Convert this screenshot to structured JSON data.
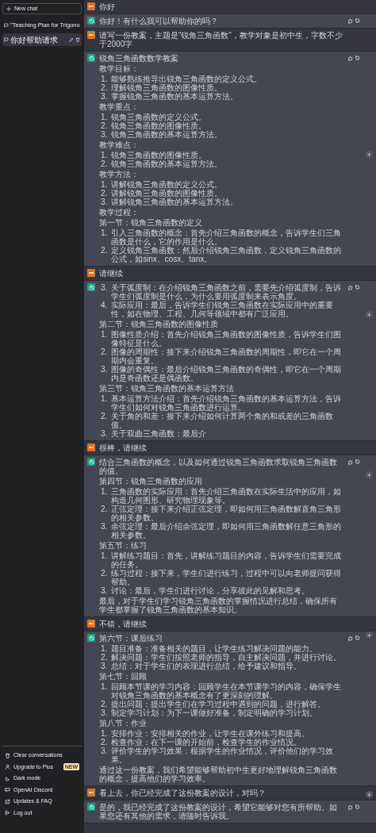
{
  "sidebar": {
    "new_chat": "New chat",
    "conversations": [
      {
        "title": "\"Teaching Plan for Trigono",
        "selected": false
      },
      {
        "title": "你好帮助请求",
        "selected": true
      }
    ],
    "menu": [
      {
        "label": "Clear conversations"
      },
      {
        "label": "Upgrade to Plus",
        "badge": "NEW"
      },
      {
        "label": "Dark mode"
      },
      {
        "label": "OpenAI Discord"
      },
      {
        "label": "Updates & FAQ"
      },
      {
        "label": "Log out"
      }
    ]
  },
  "messages": [
    {
      "kind": "user",
      "blocks": [
        {
          "kind": "p",
          "text": "你好"
        }
      ]
    },
    {
      "kind": "assistant",
      "blocks": [
        {
          "kind": "p",
          "text": "你好！有什么我可以帮助你的吗？"
        }
      ]
    },
    {
      "kind": "user",
      "blocks": [
        {
          "kind": "p",
          "text": "请写一份教案，主题是“锐角三角函数”，教学对象是初中生，字数不少于2000字"
        }
      ]
    },
    {
      "kind": "assistant",
      "blocks": [
        {
          "kind": "p",
          "text": "锐角三角函数数学教案"
        },
        {
          "kind": "p",
          "text": "教学目标："
        },
        {
          "kind": "ol",
          "items": [
            {
              "n": "1.",
              "text": "能够熟练推导出锐角三角函数的定义公式。"
            },
            {
              "n": "2.",
              "text": "理解锐角三角函数的图像性质。"
            },
            {
              "n": "3.",
              "text": "掌握锐角三角函数的基本运算方法。"
            }
          ]
        },
        {
          "kind": "p",
          "text": "教学重点："
        },
        {
          "kind": "ol",
          "items": [
            {
              "n": "1.",
              "text": "锐角三角函数的定义公式。"
            },
            {
              "n": "2.",
              "text": "锐角三角函数的图像性质。"
            },
            {
              "n": "3.",
              "text": "锐角三角函数的基本运算方法。"
            }
          ]
        },
        {
          "kind": "p",
          "text": "教学难点："
        },
        {
          "kind": "ol",
          "items": [
            {
              "n": "1.",
              "text": "锐角三角函数的图像性质。"
            },
            {
              "n": "2.",
              "text": "锐角三角函数的基本运算方法。"
            }
          ]
        },
        {
          "kind": "p",
          "text": "教学方法："
        },
        {
          "kind": "ol",
          "items": [
            {
              "n": "1.",
              "text": "讲解锐角三角函数的定义公式。"
            },
            {
              "n": "2.",
              "text": "讲解锐角三角函数的图像性质。"
            },
            {
              "n": "3.",
              "text": "讲解锐角三角函数的基本运算方法。"
            }
          ]
        },
        {
          "kind": "p",
          "text": "教学过程："
        },
        {
          "kind": "p",
          "text": "第一节：锐角三角函数的定义"
        },
        {
          "kind": "ol",
          "items": [
            {
              "n": "1.",
              "text": "引入三角函数的概念：首先介绍三角函数的概念，告诉学生们三角函数是什么，它的作用是什么。"
            },
            {
              "n": "2.",
              "text": "定义锐角三角函数：然后介绍锐角三角函数，定义锐角三角函数的公式，如sinx、cosx、tanx。"
            }
          ]
        }
      ]
    },
    {
      "kind": "user",
      "blocks": [
        {
          "kind": "p",
          "text": "请继续"
        }
      ]
    },
    {
      "kind": "assistant",
      "blocks": [
        {
          "kind": "ol",
          "items": [
            {
              "n": "3.",
              "text": "关于弧度制：在介绍锐角三角函数之前，需要先介绍弧度制，告诉学生们弧度制是什么，为什么要用弧度制来表示角度。"
            },
            {
              "n": "4.",
              "text": "实际应用：最后，告诉学生们锐角三角函数在实际应用中的重要性，如在物理、工程、几何等领域中都有广泛应用。"
            }
          ]
        },
        {
          "kind": "p",
          "text": "第二节：锐角三角函数的图像性质"
        },
        {
          "kind": "ol",
          "items": [
            {
              "n": "1.",
              "text": "图像性质介绍：首先介绍锐角三角函数的图像性质，告诉学生们图像特征是什么。"
            },
            {
              "n": "2.",
              "text": "图像的周期性：接下来介绍锐角三角函数的周期性，即它在一个周期内会重复。"
            },
            {
              "n": "3.",
              "text": "图像的奇偶性：最后介绍锐角三角函数的奇偶性，即它在一个周期内是奇函数还是偶函数。"
            }
          ]
        },
        {
          "kind": "p",
          "text": "第三节：锐角三角函数的基本运算方法"
        },
        {
          "kind": "ol",
          "items": [
            {
              "n": "1.",
              "text": "基本运算方法介绍：首先介绍锐角三角函数的基本运算方法，告诉学生们如何对锐角三角函数进行运算。"
            },
            {
              "n": "2.",
              "text": "关于角的和差：接下来介绍如何计算两个角的和或差的三角函数值。"
            },
            {
              "n": "3.",
              "text": "关于双曲三角函数：最后介"
            }
          ]
        }
      ]
    },
    {
      "kind": "user",
      "blocks": [
        {
          "kind": "p",
          "text": "很棒，请继续"
        }
      ]
    },
    {
      "kind": "assistant",
      "blocks": [
        {
          "kind": "p",
          "text": "结合三角函数的概念，以及如何通过锐角三角函数求取锐角三角函数的值。"
        },
        {
          "kind": "p",
          "text": "第四节：锐角三角函数的应用"
        },
        {
          "kind": "ol",
          "items": [
            {
              "n": "1.",
              "text": "三角函数的实际应用：首先介绍三角函数在实际生活中的应用，如构造几何图形、研究物理现象等。"
            },
            {
              "n": "2.",
              "text": "正弦定理：接下来介绍正弦定理，即如何用三角函数解直角三角形的相关参数。"
            },
            {
              "n": "3.",
              "text": "余弦定理：最后介绍余弦定理，即如何用三角函数解任意三角形的相关参数。"
            }
          ]
        },
        {
          "kind": "p",
          "text": "第五节：练习"
        },
        {
          "kind": "ol",
          "items": [
            {
              "n": "1.",
              "text": "讲解练习题目：首先，讲解练习题目的内容，告诉学生们需要完成的任务。"
            },
            {
              "n": "2.",
              "text": "练习过程：接下来，学生们进行练习，过程中可以向老师提问获得帮助。"
            },
            {
              "n": "3.",
              "text": "讨论：最后，学生们进行讨论，分享彼此的见解和思考。"
            }
          ]
        },
        {
          "kind": "p",
          "text": "最后，对于学生们学习锐角三角函数的掌握情况进行总结，确保所有学生都掌握了锐角三角函数的基本知识。"
        }
      ]
    },
    {
      "kind": "user",
      "blocks": [
        {
          "kind": "p",
          "text": "不错，请继续"
        }
      ]
    },
    {
      "kind": "assistant",
      "blocks": [
        {
          "kind": "p",
          "text": "第六节：课后练习"
        },
        {
          "kind": "ol",
          "items": [
            {
              "n": "1.",
              "text": "题目准备：准备相关的题目，让学生练习解决问题的能力。"
            },
            {
              "n": "2.",
              "text": "解决问题：学生们按照老师的指导，自主解决问题，并进行讨论。"
            },
            {
              "n": "3.",
              "text": "总结：对于学生们的表现进行总结，给予建议和指导。"
            }
          ]
        },
        {
          "kind": "p",
          "text": "第七节：回顾"
        },
        {
          "kind": "ol",
          "items": [
            {
              "n": "1.",
              "text": "回顾本节课的学习内容：回顾学生在本节课学习的内容，确保学生对锐角三角函数的基本概念有了更深刻的理解。"
            },
            {
              "n": "2.",
              "text": "提出问题：提出学生们在学习过程中遇到的问题，进行解答。"
            },
            {
              "n": "3.",
              "text": "制定学习计划：为下一课做好准备，制定明确的学习计划。"
            }
          ]
        },
        {
          "kind": "p",
          "text": "第八节：作业"
        },
        {
          "kind": "ol",
          "items": [
            {
              "n": "1.",
              "text": "安排作业：安排相关的作业，让学生在课外练习和提高。"
            },
            {
              "n": "2.",
              "text": "检查作业：在下一课的开始前，检查学生的作业情况。"
            },
            {
              "n": "3.",
              "text": "评价学生的学习效果：根据学生的作业情况，评价他们的学习效果。"
            }
          ]
        },
        {
          "kind": "p",
          "text": "通过这一份教案，我们希望能够帮助初中生更好地理解锐角三角函数的概念，提高他们的学习效率。"
        }
      ]
    },
    {
      "kind": "user",
      "blocks": [
        {
          "kind": "p",
          "text": "看上去，你已经完成了这份教案的设计，对吗？"
        }
      ]
    },
    {
      "kind": "assistant",
      "blocks": [
        {
          "kind": "p",
          "text": "是的，我已经完成了这份教案的设计，希望它能够对您有所帮助。如果您还有其他的需求，请随时告诉我。"
        }
      ]
    }
  ]
}
